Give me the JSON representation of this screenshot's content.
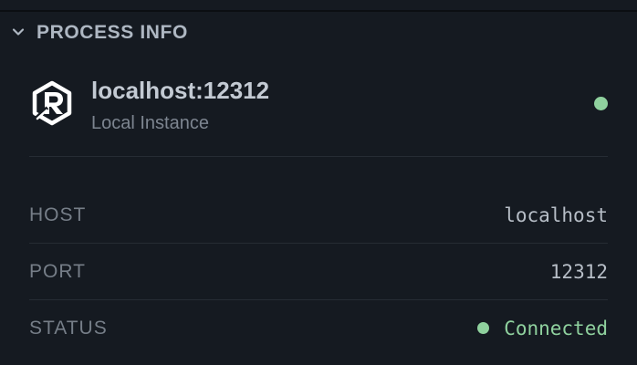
{
  "section": {
    "title": "PROCESS INFO",
    "expanded": true
  },
  "instance": {
    "name": "localhost:12312",
    "subtitle": "Local Instance",
    "logo_icon": "redis-logo-icon",
    "status_color": "#8fd19e"
  },
  "details": {
    "host": {
      "label": "HOST",
      "value": "localhost"
    },
    "port": {
      "label": "PORT",
      "value": "12312"
    },
    "status": {
      "label": "STATUS",
      "value": "Connected",
      "color": "#8fd19e"
    }
  }
}
